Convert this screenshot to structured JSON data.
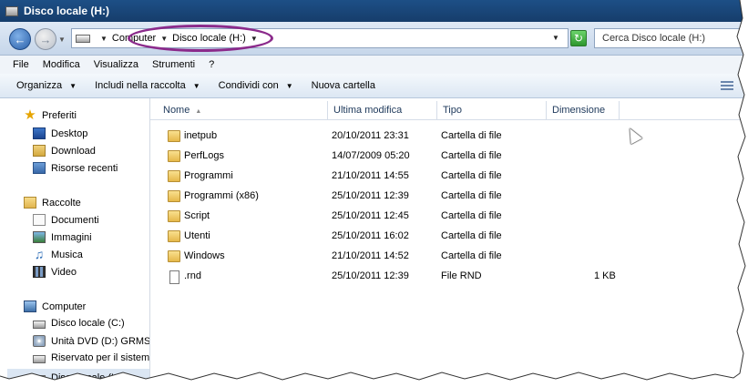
{
  "window": {
    "title": "Disco locale (H:)"
  },
  "address": {
    "crumbs": [
      "Computer",
      "Disco locale (H:)"
    ],
    "search_placeholder": "Cerca Disco locale (H:)"
  },
  "menu": [
    "File",
    "Modifica",
    "Visualizza",
    "Strumenti",
    "?"
  ],
  "toolbar": {
    "organize": "Organizza",
    "include": "Includi nella raccolta",
    "share": "Condividi con",
    "new_folder": "Nuova cartella"
  },
  "nav": {
    "favorites": {
      "label": "Preferiti",
      "items": [
        "Desktop",
        "Download",
        "Risorse recenti"
      ]
    },
    "libraries": {
      "label": "Raccolte",
      "items": [
        "Documenti",
        "Immagini",
        "Musica",
        "Video"
      ]
    },
    "computer": {
      "label": "Computer",
      "items": [
        "Disco locale (C:)",
        "Unità DVD (D:) GRMSX",
        "Riservato per il sistema",
        "Disco locale (H:)"
      ]
    }
  },
  "columns": {
    "name": "Nome",
    "modified": "Ultima modifica",
    "type": "Tipo",
    "size": "Dimensione"
  },
  "files": [
    {
      "name": "inetpub",
      "modified": "20/10/2011 23:31",
      "type": "Cartella di file",
      "size": ""
    },
    {
      "name": "PerfLogs",
      "modified": "14/07/2009 05:20",
      "type": "Cartella di file",
      "size": ""
    },
    {
      "name": "Programmi",
      "modified": "21/10/2011 14:55",
      "type": "Cartella di file",
      "size": ""
    },
    {
      "name": "Programmi (x86)",
      "modified": "25/10/2011 12:39",
      "type": "Cartella di file",
      "size": ""
    },
    {
      "name": "Script",
      "modified": "25/10/2011 12:45",
      "type": "Cartella di file",
      "size": ""
    },
    {
      "name": "Utenti",
      "modified": "25/10/2011 16:02",
      "type": "Cartella di file",
      "size": ""
    },
    {
      "name": "Windows",
      "modified": "21/10/2011 14:52",
      "type": "Cartella di file",
      "size": ""
    },
    {
      "name": ".rnd",
      "modified": "25/10/2011 12:39",
      "type": "File RND",
      "size": "1 KB"
    }
  ],
  "colors": {
    "annotation": "#8b2a8b",
    "titlebar": "#1d4f86"
  }
}
